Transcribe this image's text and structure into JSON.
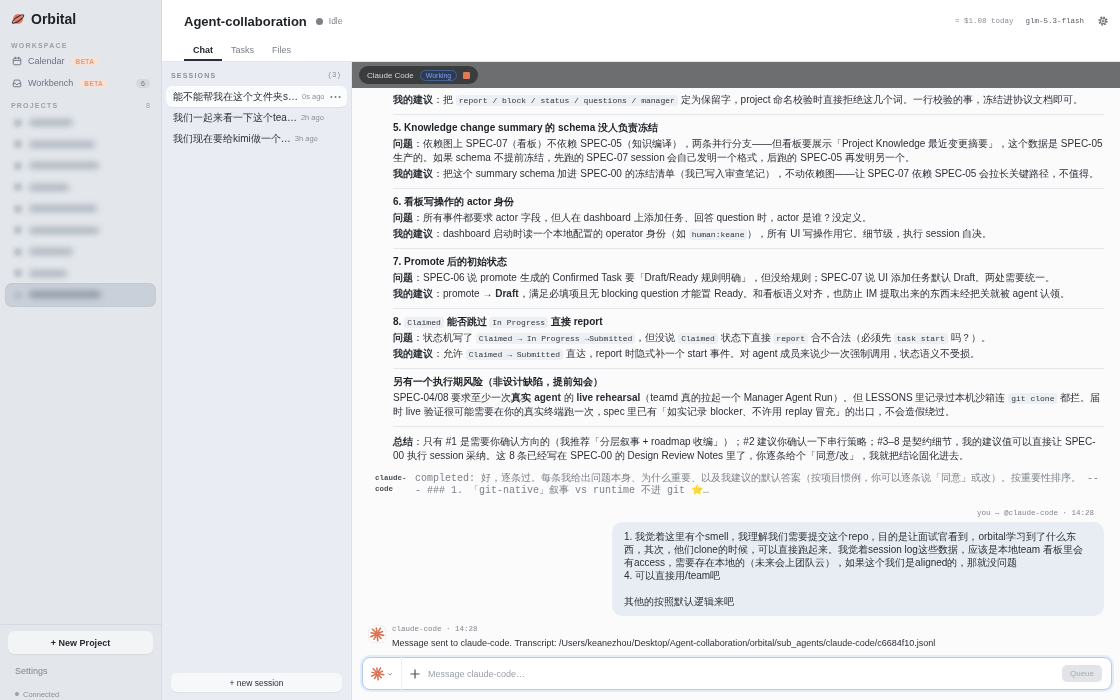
{
  "sidebar": {
    "app_name": "Orbital",
    "workspace_label": "WORKSPACE",
    "workspace_items": [
      {
        "label": "Calendar",
        "tag": "BETA"
      },
      {
        "label": "Workbench",
        "tag": "BETA",
        "count": "6"
      }
    ],
    "projects_label": "PROJECTS",
    "projects_count": "8",
    "projects": [
      {
        "selected": false
      },
      {
        "selected": false
      },
      {
        "selected": false
      },
      {
        "selected": false
      },
      {
        "selected": false
      },
      {
        "selected": false
      },
      {
        "selected": false
      },
      {
        "selected": false
      },
      {
        "selected": true
      }
    ],
    "new_project": "+ New Project",
    "settings": "Settings",
    "connection": "Connected"
  },
  "header": {
    "title": "Agent-collaboration",
    "status": "Idle",
    "cost": "≈ $1.08 today",
    "model": "glm-5.3-flash"
  },
  "tabs": [
    {
      "label": "Chat",
      "selected": true
    },
    {
      "label": "Tasks",
      "selected": false
    },
    {
      "label": "Files",
      "selected": false
    }
  ],
  "sessions": {
    "label": "SESSIONS",
    "count": "(3)",
    "items": [
      {
        "title": "能不能帮我在这个文件夹s…",
        "time": "0s ago",
        "selected": true
      },
      {
        "title": "我们一起来看一下这个tea…",
        "time": "2h ago",
        "selected": false
      },
      {
        "title": "我们现在要给kimi做一个…",
        "time": "3h ago",
        "selected": false
      }
    ],
    "new_session": "+ new session"
  },
  "agent_bar": {
    "name": "Claude Code",
    "status": "Working"
  },
  "chat": {
    "blocks": [
      {
        "kind": "paragraph",
        "parts": [
          {
            "kind": "text",
            "text": "**我的建议**：把 "
          },
          {
            "kind": "code",
            "text": "report / block / status / questions / manager"
          },
          {
            "kind": "text",
            "text": " 定为保留字，project 命名校验时直接拒绝这几个词。一行校验的事，冻结进协议文档即可。"
          }
        ]
      },
      {
        "kind": "divider"
      },
      {
        "kind": "heading",
        "parts": [
          {
            "kind": "text",
            "text": "5. Knowledge change summary 的 schema 没人负责冻结"
          }
        ]
      },
      {
        "kind": "paragraph",
        "parts": [
          {
            "kind": "text",
            "text": "**问题**：依赖图上 SPEC-07（看板）不依赖 SPEC-05（知识编译），两条并行分支——但看板要展示「Project Knowledge 最近变更摘要」，这个数据是 SPEC-05 生产的。如果 schema 不提前冻结，先跑的 SPEC-07 session 会自己发明一个格式，后跑的 SPEC-05 再发明另一个。"
          }
        ]
      },
      {
        "kind": "paragraph",
        "parts": [
          {
            "kind": "text",
            "text": "**我的建议**：把这个 summary schema 加进 SPEC-00 的冻结清单（我已写入审查笔记），不动依赖图——让 SPEC-07 依赖 SPEC-05 会拉长关键路径，不值得。"
          }
        ]
      },
      {
        "kind": "divider"
      },
      {
        "kind": "heading",
        "parts": [
          {
            "kind": "text",
            "text": "6. 看板写操作的 actor 身份"
          }
        ]
      },
      {
        "kind": "paragraph",
        "parts": [
          {
            "kind": "text",
            "text": "**问题**：所有事件都要求 actor 字段，但人在 dashboard 上添加任务、回答 question 时，actor 是谁？没定义。"
          }
        ]
      },
      {
        "kind": "paragraph",
        "parts": [
          {
            "kind": "text",
            "text": "**我的建议**：dashboard 启动时读一个本地配置的 operator 身份（如 "
          },
          {
            "kind": "code",
            "text": "human:keane"
          },
          {
            "kind": "text",
            "text": "），所有 UI 写操作用它。细节级，执行 session 自决。"
          }
        ]
      },
      {
        "kind": "divider"
      },
      {
        "kind": "heading",
        "parts": [
          {
            "kind": "text",
            "text": "7. Promote 后的初始状态"
          }
        ]
      },
      {
        "kind": "paragraph",
        "parts": [
          {
            "kind": "text",
            "text": "**问题**：SPEC-06 说 promote 生成的 Confirmed Task 要「Draft/Ready 规则明确」，但没给规则；SPEC-07 说 UI 添加任务默认 Draft。两处需要统一。"
          }
        ]
      },
      {
        "kind": "paragraph",
        "parts": [
          {
            "kind": "text",
            "text": "**我的建议**：promote → **Draft**，满足必填项且无 blocking question 才能置 Ready。和看板语义对齐，也防止 IM 提取出来的东西未经把关就被 agent 认领。"
          }
        ]
      },
      {
        "kind": "divider"
      },
      {
        "kind": "heading",
        "parts": [
          {
            "kind": "text",
            "text": "8. "
          },
          {
            "kind": "code",
            "text": "Claimed"
          },
          {
            "kind": "text",
            "text": " 能否跳过 "
          },
          {
            "kind": "code",
            "text": "In Progress"
          },
          {
            "kind": "text",
            "text": " 直接 report"
          }
        ]
      },
      {
        "kind": "paragraph",
        "parts": [
          {
            "kind": "text",
            "text": "**问题**：状态机写了 "
          },
          {
            "kind": "code",
            "text": "Claimed → In Progress →Submitted"
          },
          {
            "kind": "text",
            "text": "，但没说 "
          },
          {
            "kind": "code",
            "text": "Claimed"
          },
          {
            "kind": "text",
            "text": " 状态下直接 "
          },
          {
            "kind": "code",
            "text": "report"
          },
          {
            "kind": "text",
            "text": " 合不合法（必须先 "
          },
          {
            "kind": "code",
            "text": "task start"
          },
          {
            "kind": "text",
            "text": " 吗？）。"
          }
        ]
      },
      {
        "kind": "paragraph",
        "parts": [
          {
            "kind": "text",
            "text": "**我的建议**：允许 "
          },
          {
            "kind": "code",
            "text": "Claimed → Submitted"
          },
          {
            "kind": "text",
            "text": " 直达，report 时隐式补一个 start 事件。对 agent 成员来说少一次强制调用，状态语义不受损。"
          }
        ]
      },
      {
        "kind": "divider"
      },
      {
        "kind": "heading",
        "parts": [
          {
            "kind": "text",
            "text": "另有一个执行期风险（非设计缺陷，提前知会）"
          }
        ]
      },
      {
        "kind": "paragraph",
        "parts": [
          {
            "kind": "text",
            "text": "SPEC-04/08 要求至少一次**真实 agent** 的 **live rehearsal**（teamd 真的拉起一个 Manager Agent Run）。但 LESSONS 里记录过本机沙箱连 "
          },
          {
            "kind": "code",
            "text": "git clone"
          },
          {
            "kind": "text",
            "text": " 都拦。届时 live 验证很可能需要在你的真实终端跑一次，spec 里已有「如实记录 blocker、不许用 replay 冒充」的出口，不会造假绕过。"
          }
        ]
      },
      {
        "kind": "divider"
      },
      {
        "kind": "paragraph",
        "parts": [
          {
            "kind": "text",
            "text": "**总结**：只有 #1 是需要你确认方向的（我推荐「分层叙事 + roadmap 收编」）；#2 建议你确认一下串行策略；#3–8 是契约细节，我的建议值可以直接让 SPEC-00 执行 session 采纳。这 8 条已经写在 SPEC-00 的 Design Review Notes 里了，你逐条给个「同意/改」，我就把结论固化进去。"
          }
        ]
      }
    ],
    "tool_event": {
      "sender": "claude-code",
      "text": "completed: 好，逐条过。每条我给出问题本身、为什么重要、以及我建议的默认答案（按项目惯例，你可以逐条说「同意」或改）。按重要性排序。 --- ### 1. 「git-native」叙事 vs runtime 不进 git ⭐…"
    },
    "user_message": {
      "meta": "you → @claude-code · 14:28",
      "paragraphs": [
        {
          "lines": [
            "1. 我觉着这里有个smell，我理解我们需要提交这个repo，目的是让面试官看到，orbital学习到了什么东西，其次，他们clone的时候，可以直接跑起来。我觉着session log这些数据，应该是本地team 看板里会有access，需要存在本地的（未来会上团队云），如果这个我们是aligned的，那就没问题",
            "4. 可以直接用/team吧"
          ]
        },
        {
          "lines": [
            "其他的按照默认逻辑来吧"
          ]
        }
      ]
    },
    "agent_message": {
      "meta": "claude-code · 14:28",
      "text": "Message sent to claude-code. Transcript: /Users/keanezhou/Desktop/Agent-collaboration/orbital/sub_agents/claude-code/c6684f10.jsonl"
    }
  },
  "composer": {
    "placeholder": "Message claude-code…",
    "button": "Queue",
    "button_disabled": true
  }
}
